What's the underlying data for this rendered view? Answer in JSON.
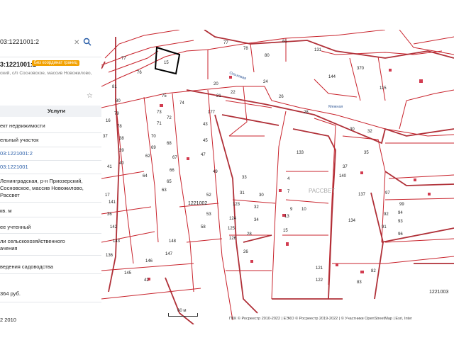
{
  "search": {
    "value": "03:1221001:2"
  },
  "object": {
    "cadastral_number": "3:1221001:2",
    "badge": "Без координат границ",
    "address": "ский, с/п Сосновское, массив Новожилово,"
  },
  "tabs": {
    "second": "Услуги"
  },
  "details": [
    "ект недвижимости",
    "ельный участок",
    "03:1221001:2",
    "03:1221001",
    "Ленинградская, р-н Приозерский,",
    "Сосновское, массив Новожилово,",
    "Рассвет",
    "кв. м",
    "ее учтенный",
    "ли сельскохозяйственного",
    "ачения",
    "ведения садоводства",
    "364 руб.",
    "2 2010"
  ],
  "map": {
    "quarter_labels": [
      "1221002",
      "1221003"
    ],
    "massif_label": "РАССВЕТ",
    "streets": [
      "Ольховая",
      "Межная"
    ],
    "scale_label": "60 м",
    "attribution": "ПКК © Росреестр 2010-2022 | ЕЭКО © Росреестр 2019-2022 | © Участники OpenStreetMap | Esri, Inter",
    "parcel_numbers": [
      "77",
      "76",
      "81",
      "80",
      "79",
      "78",
      "15",
      "75",
      "74",
      "73",
      "72",
      "71",
      "70",
      "69",
      "68",
      "67",
      "66",
      "65",
      "64",
      "63",
      "62",
      "61",
      "177",
      "43",
      "44",
      "45",
      "46",
      "47",
      "48",
      "49",
      "50",
      "51",
      "52",
      "53",
      "54",
      "55",
      "58",
      "77",
      "78",
      "80",
      "81",
      "131",
      "144",
      "370",
      "115",
      "20",
      "21",
      "22",
      "23",
      "24",
      "25",
      "26",
      "27",
      "28",
      "29",
      "30",
      "32",
      "35",
      "37",
      "140",
      "137",
      "135",
      "134",
      "133",
      "130",
      "4",
      "6",
      "7",
      "8",
      "9",
      "10",
      "11",
      "12",
      "13",
      "14",
      "15",
      "16",
      "17",
      "18",
      "19",
      "121",
      "122",
      "123",
      "124",
      "125",
      "126",
      "127",
      "33",
      "31",
      "30",
      "32",
      "34",
      "28",
      "26",
      "24",
      "22",
      "20",
      "95",
      "94",
      "93",
      "96",
      "92",
      "99",
      "91",
      "97",
      "81",
      "82",
      "83",
      "84",
      "85",
      "86",
      "87",
      "88",
      "89",
      "148",
      "147",
      "146",
      "145",
      "143",
      "142",
      "141",
      "138",
      "136",
      "36",
      "37",
      "38",
      "39",
      "40",
      "41",
      "42",
      "16",
      "17"
    ]
  }
}
